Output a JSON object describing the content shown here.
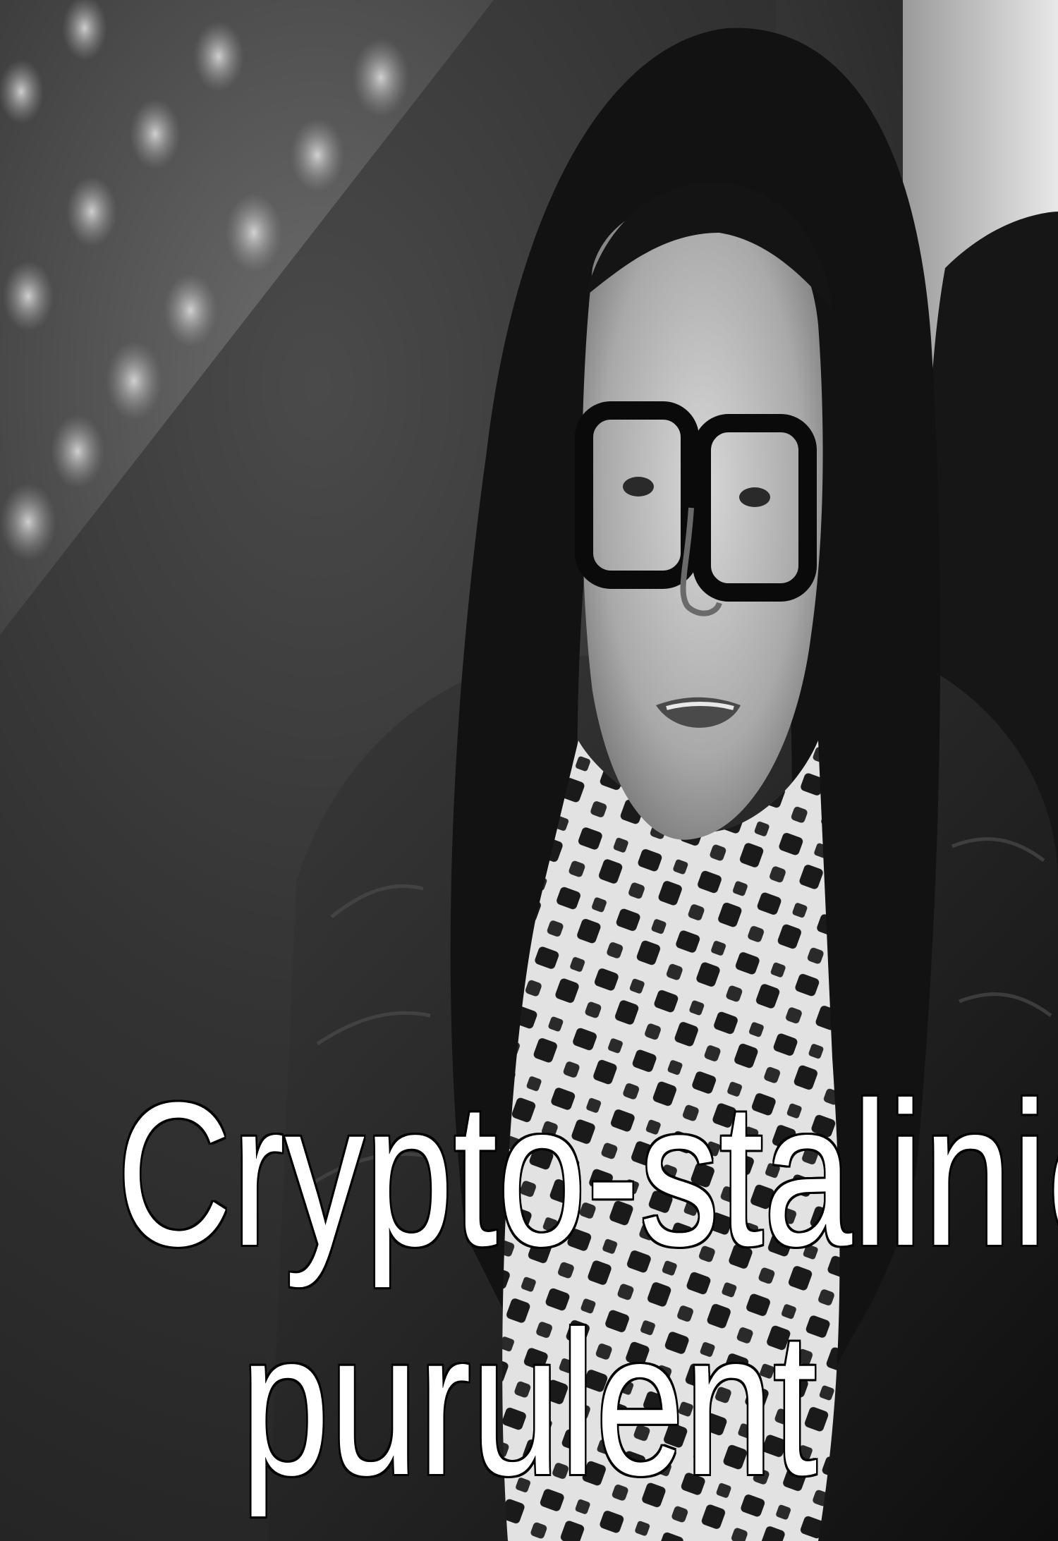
{
  "caption": {
    "line1": "Crypto-stalinien",
    "line2": "purulent"
  }
}
